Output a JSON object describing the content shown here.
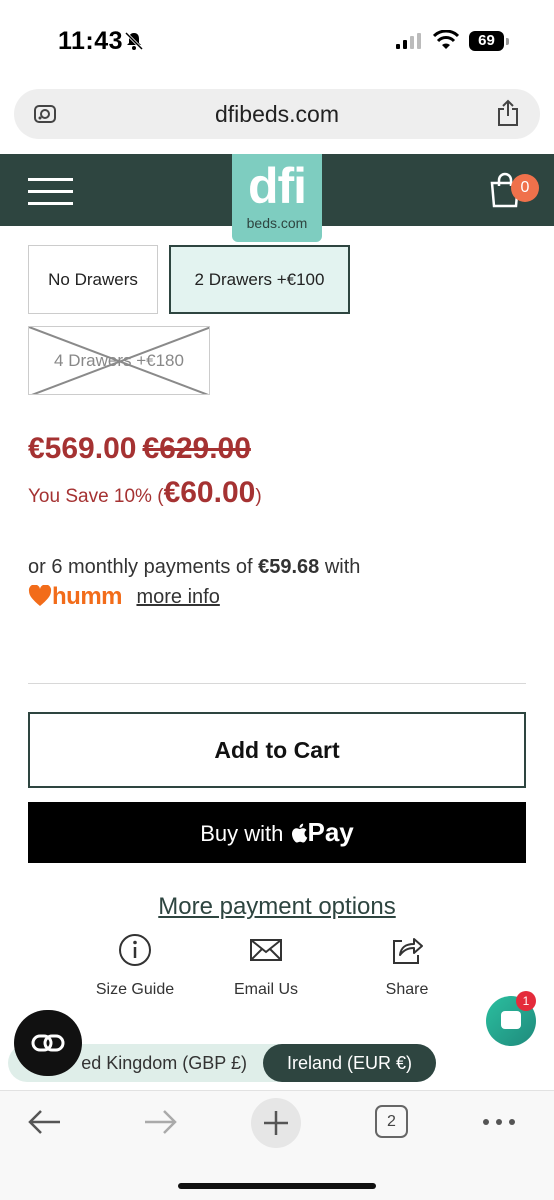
{
  "status": {
    "time": "11:43",
    "battery": "69"
  },
  "browser": {
    "url": "dfibeds.com",
    "tabs_count": "2"
  },
  "header": {
    "logo_main": "dfi",
    "logo_sub": "beds.com",
    "cart_count": "0"
  },
  "options": [
    {
      "label": "No Drawers",
      "selected": false,
      "available": true
    },
    {
      "label": "2 Drawers  +€100",
      "selected": true,
      "available": true
    },
    {
      "label": "4 Drawers  +€180",
      "selected": false,
      "available": false
    }
  ],
  "pricing": {
    "price": "€569.00",
    "old_price": "€629.00",
    "save_prefix": "You Save 10% (",
    "save_amount": "€60.00",
    "save_suffix": ")"
  },
  "humm": {
    "line_prefix": "or 6 monthly payments of ",
    "amount": "€59.68",
    "line_suffix": " with",
    "brand": "humm",
    "link": "more info"
  },
  "buttons": {
    "add_to_cart": "Add to Cart",
    "buy_with": "Buy with ",
    "pay_word": "Pay",
    "more_payment": "More payment options"
  },
  "actions": {
    "size_guide": "Size Guide",
    "email_us": "Email Us",
    "share": "Share"
  },
  "chat": {
    "badge": "1"
  },
  "currency": {
    "uk": "ed Kingdom (GBP £)",
    "ie": "Ireland (EUR €)"
  },
  "colors": {
    "brand_dark": "#2e4540",
    "logo_teal": "#7ecdc0",
    "price_red": "#a53232",
    "humm_orange": "#f26c1a",
    "cart_badge": "#f0714b"
  }
}
